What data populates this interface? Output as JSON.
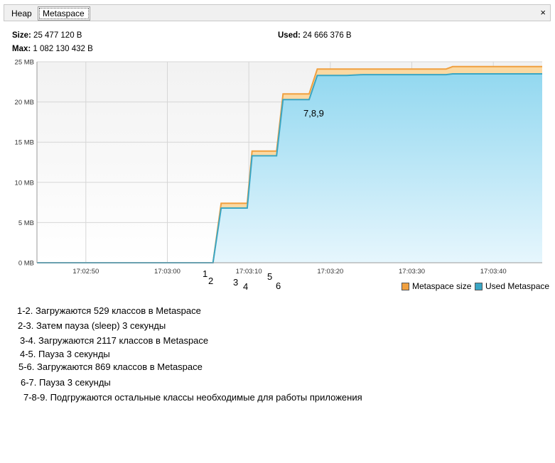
{
  "tabs": [
    {
      "label": "Heap",
      "active": false
    },
    {
      "label": "Metaspace",
      "active": true
    }
  ],
  "close_icon": "×",
  "stats": {
    "size_label": "Size:",
    "size_value": "25 477 120 B",
    "max_label": "Max:",
    "max_value": "1 082 130 432 B",
    "used_label": "Used:",
    "used_value": "24 666 376 B"
  },
  "colors": {
    "metaspace_size": "#f0a040",
    "used_metaspace": "#3aa6c4",
    "used_fill_top": "#93d8f0",
    "used_fill_bottom": "#e6f6fd"
  },
  "chart_data": {
    "type": "area",
    "y_unit": "MB",
    "ylim": [
      0,
      25
    ],
    "y_ticks": [
      0,
      5,
      10,
      15,
      20,
      25
    ],
    "y_tick_labels": [
      "0 MB",
      "5 MB",
      "10 MB",
      "15 MB",
      "20 MB",
      "25 MB"
    ],
    "xlim": [
      "17:02:44",
      "17:03:46"
    ],
    "x_ticks": [
      "17:02:50",
      "17:03:00",
      "17:03:10",
      "17:03:20",
      "17:03:30",
      "17:03:40"
    ],
    "grid": true,
    "legend_position": "bottom-right",
    "series": [
      {
        "name": "Metaspace size",
        "points": [
          [
            "17:02:44",
            0
          ],
          [
            "17:03:05.6",
            0
          ],
          [
            "17:03:06.6",
            7.4
          ],
          [
            "17:03:09.8",
            7.4
          ],
          [
            "17:03:10.4",
            13.9
          ],
          [
            "17:03:13.4",
            13.9
          ],
          [
            "17:03:14.2",
            21.0
          ],
          [
            "17:03:17.4",
            21.0
          ],
          [
            "17:03:18.4",
            24.1
          ],
          [
            "17:03:34.2",
            24.1
          ],
          [
            "17:03:35",
            24.4
          ],
          [
            "17:03:46",
            24.4
          ]
        ]
      },
      {
        "name": "Used Metaspace",
        "points": [
          [
            "17:02:44",
            0
          ],
          [
            "17:03:05.6",
            0
          ],
          [
            "17:03:06.6",
            6.8
          ],
          [
            "17:03:09.8",
            6.8
          ],
          [
            "17:03:10.4",
            13.3
          ],
          [
            "17:03:13.4",
            13.3
          ],
          [
            "17:03:14.2",
            20.3
          ],
          [
            "17:03:17.4",
            20.3
          ],
          [
            "17:03:18.4",
            23.3
          ],
          [
            "17:03:22",
            23.3
          ],
          [
            "17:03:24",
            23.4
          ],
          [
            "17:03:34.2",
            23.4
          ],
          [
            "17:03:35",
            23.5
          ],
          [
            "17:03:46",
            23.5
          ]
        ]
      }
    ],
    "annotations": [
      {
        "text": "1",
        "time": "17:03:05.6"
      },
      {
        "text": "2",
        "time": "17:03:06.4"
      },
      {
        "text": "3",
        "time": "17:03:09.6"
      },
      {
        "text": "4",
        "time": "17:03:10.4"
      },
      {
        "text": "5",
        "time": "17:03:13.4"
      },
      {
        "text": "6",
        "time": "17:03:14.4"
      },
      {
        "text": "7,8,9",
        "time": "17:03:18.3"
      }
    ]
  },
  "notes": [
    "1-2. Загружаются 529 классов в Metaspace",
    "2-3. Затем пауза (sleep) 3  секунды",
    "3-4. Загружаются 2117 классов в Metaspace",
    "4-5. Пауза 3 секунды",
    "5-6. Загружаются 869 классов в Metaspace",
    "6-7. Пауза 3 секунды",
    "7-8-9.   Подгружаются остальные классы необходимые для работы приложения"
  ]
}
